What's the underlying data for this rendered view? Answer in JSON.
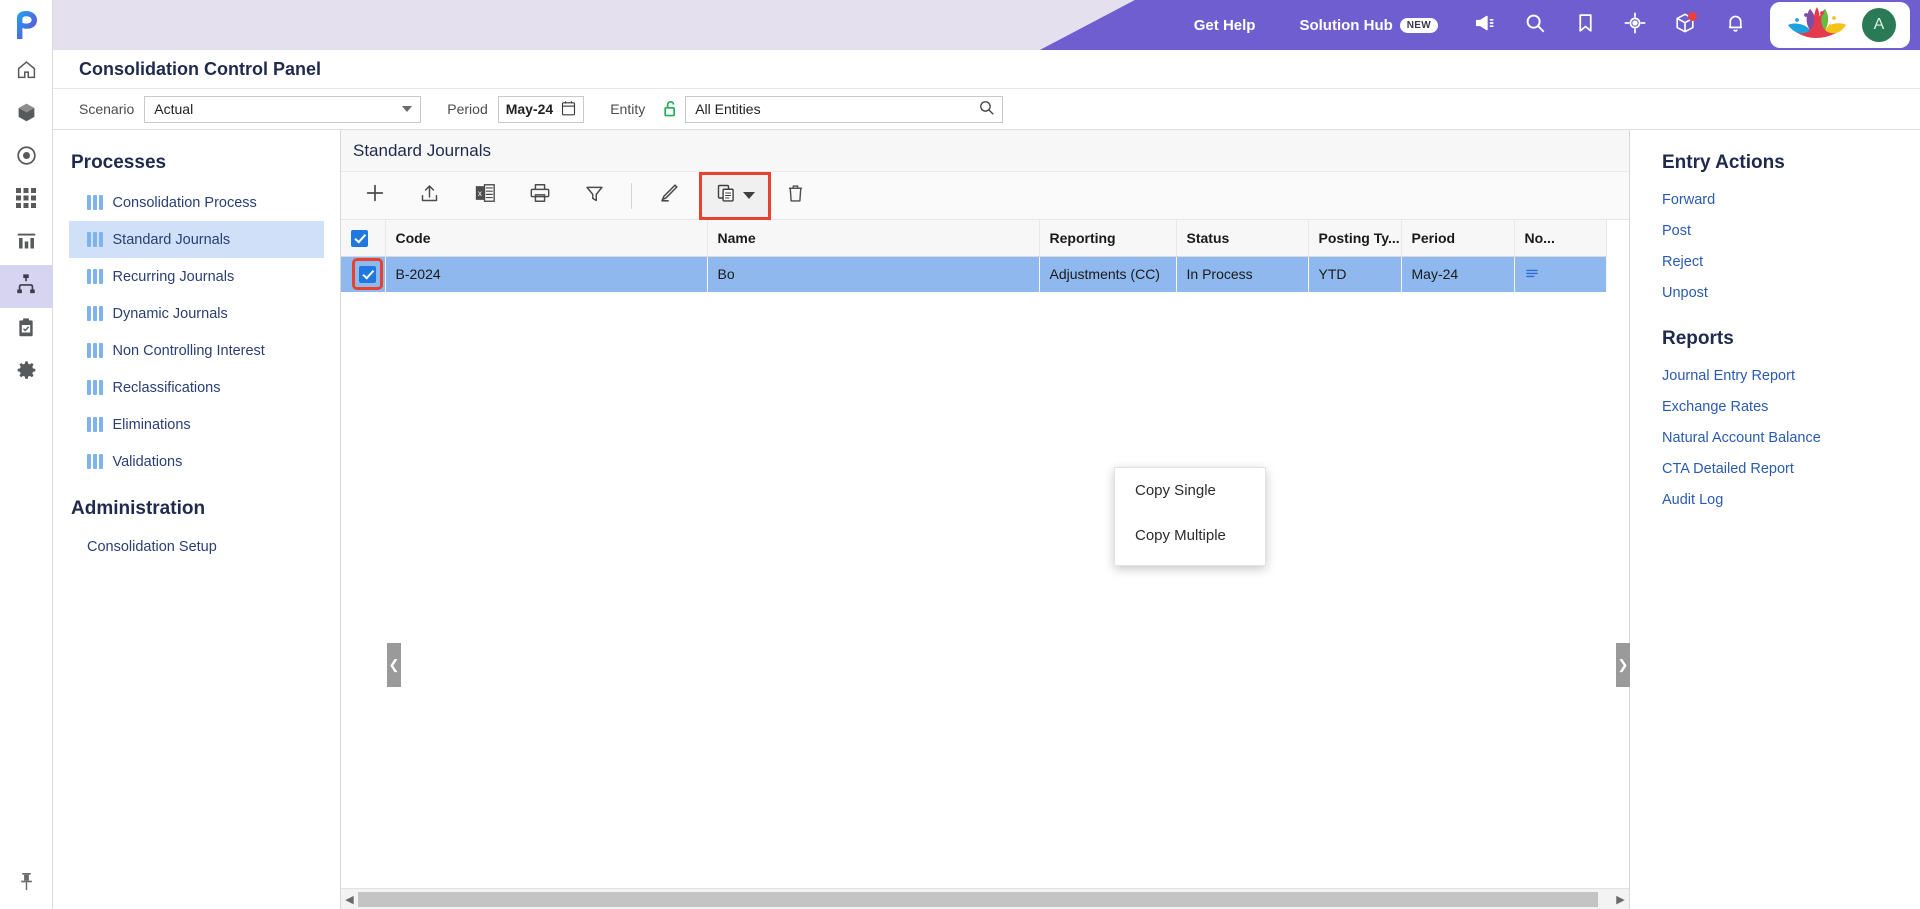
{
  "app": {
    "logo_name": "p-logo",
    "page_title": "Consolidation Control Panel"
  },
  "topbar": {
    "get_help": "Get Help",
    "solution_hub": "Solution Hub",
    "new_badge": "NEW",
    "icons": [
      "megaphone-icon",
      "search-icon",
      "bookmark-icon",
      "target-icon",
      "cube-icon",
      "bell-icon"
    ],
    "brand_mark": "lotus-logo",
    "avatar_initial": "A"
  },
  "rail": {
    "items": [
      {
        "name": "home-icon"
      },
      {
        "name": "cube-icon"
      },
      {
        "name": "target-circle-icon"
      },
      {
        "name": "grid-icon"
      },
      {
        "name": "chart-icon"
      },
      {
        "name": "hierarchy-icon",
        "active": true
      },
      {
        "name": "clipboard-check-icon"
      },
      {
        "name": "gear-icon"
      }
    ],
    "pin": "pin-icon"
  },
  "filters": {
    "scenario_label": "Scenario",
    "scenario_value": "Actual",
    "period_label": "Period",
    "period_value": "May-24",
    "entity_label": "Entity",
    "entity_value": "All Entities",
    "entity_placeholder": "All Entities"
  },
  "left_panel": {
    "processes_title": "Processes",
    "processes": [
      {
        "label": "Consolidation Process",
        "active": false
      },
      {
        "label": "Standard Journals",
        "active": true
      },
      {
        "label": "Recurring Journals",
        "active": false
      },
      {
        "label": "Dynamic Journals",
        "active": false
      },
      {
        "label": "Non Controlling Interest",
        "active": false
      },
      {
        "label": "Reclassifications",
        "active": false
      },
      {
        "label": "Eliminations",
        "active": false
      },
      {
        "label": "Validations",
        "active": false
      }
    ],
    "administration_title": "Administration",
    "administration": [
      {
        "label": "Consolidation Setup"
      }
    ]
  },
  "center_panel": {
    "title": "Standard Journals",
    "toolbar": [
      {
        "name": "add-icon",
        "label": "Add"
      },
      {
        "name": "upload-icon",
        "label": "Import"
      },
      {
        "name": "excel-export-icon",
        "label": "Export to Excel"
      },
      {
        "name": "print-icon",
        "label": "Print"
      },
      {
        "name": "filter-icon",
        "label": "Filter"
      },
      {
        "name": "edit-icon",
        "label": "Edit"
      },
      {
        "name": "copy-icon",
        "label": "Copy"
      },
      {
        "name": "delete-icon",
        "label": "Delete"
      }
    ],
    "copy_menu": {
      "items": [
        "Copy Single",
        "Copy Multiple"
      ]
    },
    "columns": [
      "",
      "Code",
      "Name",
      "Reporting",
      "Status",
      "Posting Ty...",
      "Period",
      "No..."
    ],
    "rows": [
      {
        "selected": true,
        "code": "B-2024",
        "name": "Bo",
        "reporting": "Adjustments (CC)",
        "status": "In Process",
        "posting_type": "YTD",
        "period": "May-24",
        "notes": "notes-icon"
      }
    ]
  },
  "right_panel": {
    "entry_actions_title": "Entry Actions",
    "entry_actions": [
      "Forward",
      "Post",
      "Reject",
      "Unpost"
    ],
    "reports_title": "Reports",
    "reports": [
      "Journal Entry Report",
      "Exchange Rates",
      "Natural Account Balance",
      "CTA Detailed Report",
      "Audit Log"
    ]
  },
  "colors": {
    "header_purple": "#6f5ed0",
    "header_lilac": "#e4e0ee",
    "row_selected": "#8fb8ef",
    "nav_active": "#cfe0f8",
    "highlight_red": "#e8422f",
    "checkbox_blue": "#1f78e0",
    "link_blue": "#2a5bb0",
    "lock_green": "#1faa55"
  }
}
